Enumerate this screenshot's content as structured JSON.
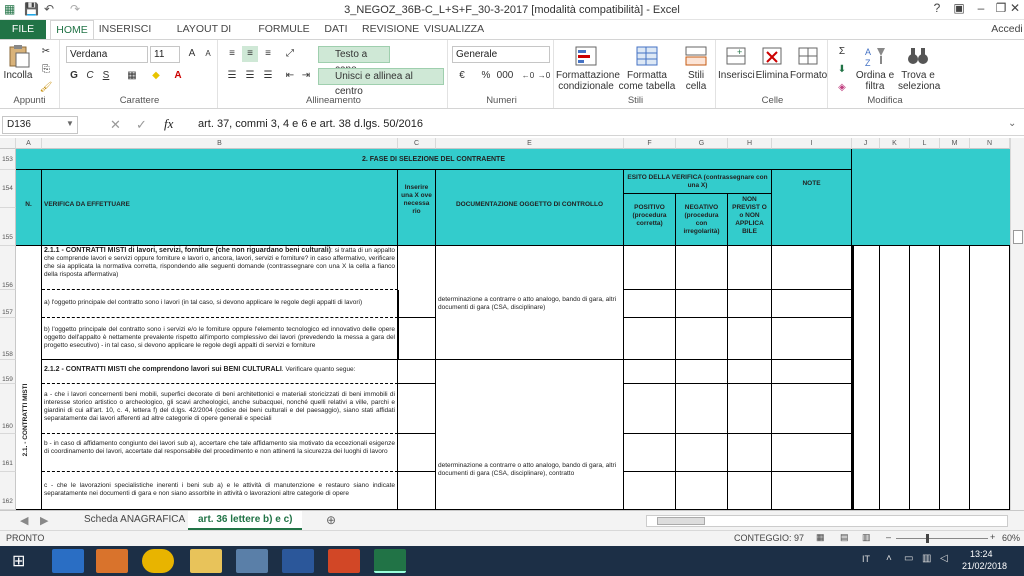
{
  "window": {
    "title": "3_NEGOZ_36B-C_L+S+F_30-3-2017  [modalità compatibilità] - Excel"
  },
  "tabs": [
    "FILE",
    "HOME",
    "INSERISCI",
    "LAYOUT DI PAGINA",
    "FORMULE",
    "DATI",
    "REVISIONE",
    "VISUALIZZA"
  ],
  "user": "Accedi",
  "ribbon": {
    "appunti": {
      "label": "Appunti",
      "paste": "Incolla"
    },
    "carattere": {
      "label": "Carattere",
      "font": "Verdana",
      "size": "11",
      "bold": "G",
      "italic": "C",
      "underline": "S"
    },
    "allineamento": {
      "label": "Allineamento",
      "wrap": "Testo a capo",
      "merge": "Unisci e allinea al centro"
    },
    "numeri": {
      "label": "Numeri",
      "format": "Generale",
      "pct": "%",
      "thousands": "000"
    },
    "stili": {
      "label": "Stili",
      "cond": "Formattazione condizionale",
      "table": "Formatta come tabella",
      "cell": "Stili cella"
    },
    "celle": {
      "label": "Celle",
      "insert": "Inserisci",
      "delete": "Elimina",
      "format": "Formato"
    },
    "modifica": {
      "label": "Modifica",
      "sort": "Ordina e filtra",
      "find": "Trova e seleziona"
    }
  },
  "formula": {
    "namebox": "D136",
    "fx": "fx",
    "content": "art. 37, commi 3, 4 e 6 e art. 38 d.lgs. 50/2016"
  },
  "columns": [
    "A",
    "B",
    "C",
    "E",
    "F",
    "G",
    "H",
    "I",
    "J",
    "K",
    "L",
    "M",
    "N"
  ],
  "rows": [
    "153",
    "154",
    "155",
    "156",
    "157",
    "158",
    "159",
    "160",
    "161",
    "162"
  ],
  "sheet": {
    "section_title": "2. FASE DI SELEZIONE DEL CONTRAENTE",
    "n_header": "N.",
    "verify_header": "VERIFICA DA EFFETTUARE",
    "insert_x": "Inserire una X ove necessa rio",
    "doc_header": "DOCUMENTAZIONE OGGETTO DI CONTROLLO",
    "esito_header": "ESITO DELLA VERIFICA (contrassegnare con una X)",
    "positivo": "POSITIVO (procedura corretta)",
    "negativo": "NEGATIVO (procedura con irregolarità)",
    "non_previsto": "NON PREVIST O o NON APPLICA BILE",
    "note": "NOTE",
    "vertical_label": "2.1. - CONTRATTI MISTI",
    "r156_title": "2.1.1 - CONTRATTI MISTI di lavori, servizi, forniture (che non riguardano beni culturali)",
    "r156_text": ": si tratta di un appalto che comprende lavori e servizi oppure forniture e lavori o, ancora, lavori, servizi e forniture? in caso affermativo, verificare che sia applicata la normativa corretta, rispondendo alle seguenti domande (contrassegnare con una X la cella a fianco della risposta affermativa)",
    "r157_text": "a) l'oggetto principale del contratto sono i lavori (in tal caso, si devono applicare le regole degli appalti di lavori)",
    "r157_doc": "determinazione a contrarre o atto analogo, bando di gara, altri documenti di gara (CSA, disciplinare)",
    "r158_text": "b) l'oggetto principale del contratto sono i servizi e/o le forniture oppure l'elemento tecnologico ed innovativo delle opere oggetto dell'appalto è nettamente prevalente rispetto all'importo complessivo dei lavori (prevedendo la messa a gara del progetto esecutivo) - in tal caso, si devono applicare le regole degli appalti di servizi e forniture",
    "r159_title": "2.1.2 - CONTRATTI MISTI che comprendono lavori sui BENI CULTURALI",
    "r159_text": ". Verificare quanto segue:",
    "r160_text": "a - che i lavori concernenti beni mobili, superfici decorate di beni architettonici e materiali storicizzati di beni immobili di interesse storico artistico o archeologico, gli scavi archeologici, anche subacquei, nonché quelli relativi a ville, parchi e giardini di cui all'art. 10, c. 4, lettera f) del d.lgs. 42/2004 (codice dei beni culturali e del paesaggio), siano stati affidati separatamente dai lavori afferenti ad altre categorie di opere generali e speciali",
    "r161_text": "b - in caso di affidamento congiunto dei lavori sub a), accertare che tale affidamento sia motivato da eccezionali esigenze di coordinamento dei lavori, accertate dal responsabile del procedimento e non attinenti la sicurezza dei luoghi di lavoro",
    "r161_doc": "determinazione a contrarre o atto analogo, bando di gara, altri documenti di gara (CSA, disciplinare), contratto",
    "r162_text": "c - che le lavorazioni specialistiche inerenti i beni sub a) e le attività di manutenzione e restauro siano indicate separatamente nei documenti di gara e non siano assorbite in attività o lavorazioni altre categorie di opere"
  },
  "sheettabs": [
    "Scheda ANAGRAFICA",
    "art. 36 lettere b) e c)"
  ],
  "status": {
    "ready": "PRONTO",
    "count": "CONTEGGIO: 97",
    "zoom": "60%"
  },
  "taskbar": {
    "lang": "IT",
    "time": "13:24",
    "date": "21/02/2018"
  },
  "colors": {
    "excel_green": "#217346",
    "teal": "#33cccc",
    "taskbar": "#1c2f46"
  }
}
